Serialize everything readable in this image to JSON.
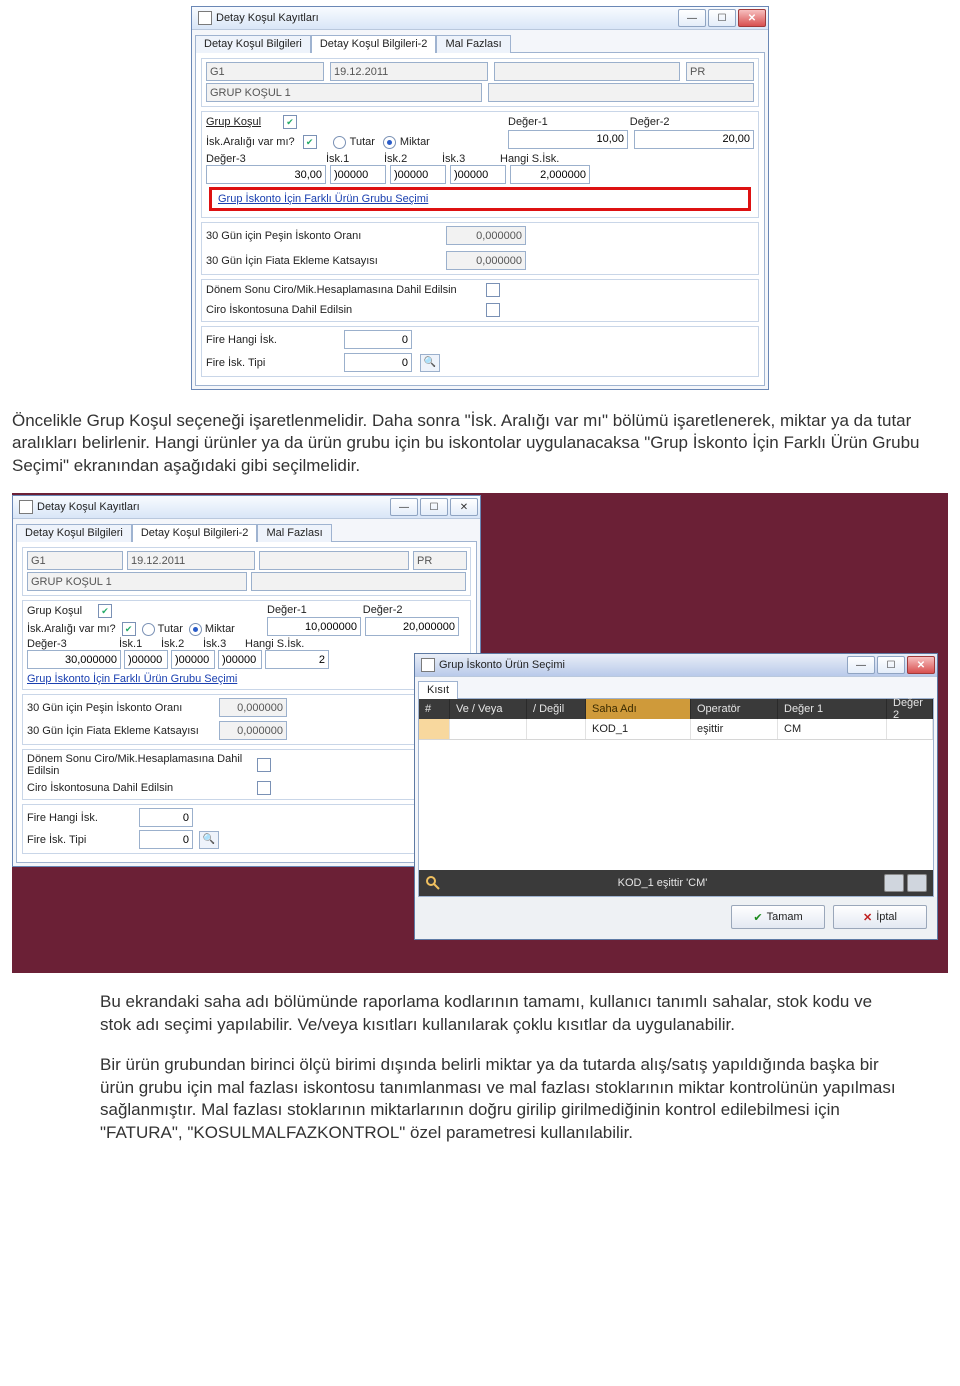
{
  "window1": {
    "title": "Detay Koşul Kayıtları",
    "tabs": [
      "Detay Koşul Bilgileri",
      "Detay Koşul Bilgileri-2",
      "Mal Fazlası"
    ],
    "active_tab": 1,
    "code": "G1",
    "date": "19.12.2011",
    "fiyat": "PR",
    "name": "GRUP KOŞUL 1",
    "labels": {
      "grup_kosul": "Grup Koşul",
      "isk_araligi": "İsk.Aralığı var mı?",
      "tutar": "Tutar",
      "miktar": "Miktar",
      "deger1": "Değer-1",
      "deger2": "Değer-2",
      "deger3": "Değer-3",
      "isk1": "İsk.1",
      "isk2": "İsk.2",
      "isk3": "İsk.3",
      "hangi": "Hangi S.İsk.",
      "link": "Grup İskonto İçin Farklı  Ürün Grubu Seçimi",
      "pesin": "30 Gün için Peşin İskonto Oranı",
      "fiata": "30 Gün İçin Fiata Ekleme Katsayısı",
      "donem": "Dönem Sonu Ciro/Mik.Hesaplamasına Dahil Edilsin",
      "ciro": "Ciro İskontosuna Dahil Edilsin",
      "fire_hangi": "Fire Hangi İsk.",
      "fire_tipi": "Fire İsk. Tipi"
    },
    "vals": {
      "deger1": "10,00",
      "deger2": "20,00",
      "deger3": "30,00",
      "isk1": ")00000",
      "isk2": ")00000",
      "isk3": ")00000",
      "hangi": "2,000000",
      "pesin": "0,000000",
      "fiata": "0,000000",
      "fire_hangi": "0",
      "fire_tipi": "0"
    }
  },
  "paragraph1": "Öncelikle Grup Koşul seçeneği işaretlenmelidir. Daha sonra \"İsk. Aralığı var mı\" bölümü işaretlenerek, miktar ya da tutar aralıkları belirlenir. Hangi ürünler ya da ürün grubu için bu iskontolar uygulanacaksa \"Grup İskonto İçin Farklı Ürün Grubu Seçimi\" ekranından aşağıdaki gibi seçilmelidir.",
  "window1b_vals": {
    "deger1": "10,000000",
    "deger2": "20,000000",
    "deger3": "30,000000",
    "isk1": ")00000",
    "isk2": ")00000",
    "isk3": ")00000",
    "hangi": "2"
  },
  "window2": {
    "title": "Grup İskonto Ürün Seçimi",
    "tab": "Kısıt",
    "headers": {
      "num": "#",
      "veveya": "Ve / Veya",
      "degil": "/ Değil",
      "saha": "Saha Adı",
      "op": "Operatör",
      "d1": "Değer 1",
      "d2": "Değer 2"
    },
    "row": {
      "saha": "KOD_1",
      "op": "eşittir",
      "d1": "CM"
    },
    "status": "KOD_1 eşittir 'CM'",
    "btn_ok": "Tamam",
    "btn_cancel": "İptal"
  },
  "paragraph2": "Bu ekrandaki saha adı bölümünde raporlama kodlarının tamamı, kullanıcı tanımlı sahalar, stok kodu ve stok adı seçimi yapılabilir. Ve/veya kısıtları kullanılarak çoklu kısıtlar da uygulanabilir.",
  "paragraph3": "Bir ürün grubundan birinci ölçü birimi dışında belirli miktar ya da tutarda alış/satış yapıldığında başka bir ürün grubu için mal fazlası iskontosu tanımlanması ve mal fazlası stoklarının miktar kontrolünün yapılması sağlanmıştır. Mal fazlası stoklarının miktarlarının doğru girilip girilmediğinin kontrol edilebilmesi için \"FATURA\", \"KOSULMALFAZKONTROL\" özel parametresi kullanılabilir."
}
